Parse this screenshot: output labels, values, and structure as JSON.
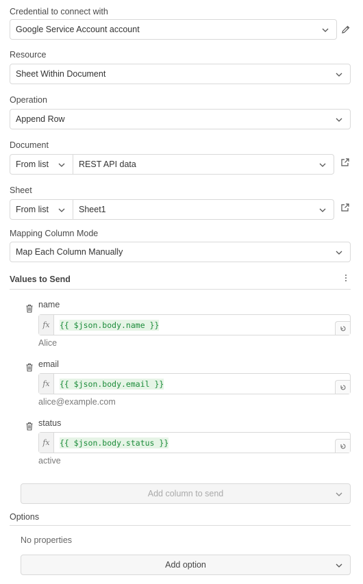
{
  "credential": {
    "label": "Credential to connect with",
    "value": "Google Service Account account"
  },
  "resource": {
    "label": "Resource",
    "value": "Sheet Within Document"
  },
  "operation": {
    "label": "Operation",
    "value": "Append Row"
  },
  "document": {
    "label": "Document",
    "mode": "From list",
    "value": "REST API data"
  },
  "sheet": {
    "label": "Sheet",
    "mode": "From list",
    "value": "Sheet1"
  },
  "mapping": {
    "label": "Mapping Column Mode",
    "value": "Map Each Column Manually"
  },
  "values_section": {
    "title": "Values to Send",
    "fields": [
      {
        "name": "name",
        "expression": "{{ $json.body.name }}",
        "preview": "Alice"
      },
      {
        "name": "email",
        "expression": "{{ $json.body.email }}",
        "preview": "alice@example.com"
      },
      {
        "name": "status",
        "expression": "{{ $json.body.status }}",
        "preview": "active"
      }
    ],
    "fx_label": "fx",
    "add_column_label": "Add column to send"
  },
  "options": {
    "title": "Options",
    "empty_text": "No properties",
    "add_label": "Add option"
  },
  "colors": {
    "border": "#d9d9d9",
    "expression_green": "#1c8c3a",
    "expression_bg": "#e6f4e6"
  },
  "icons": [
    "chevron-down-icon",
    "pencil-icon",
    "external-link-icon",
    "trash-icon",
    "more-vertical-icon",
    "expand-icon"
  ]
}
